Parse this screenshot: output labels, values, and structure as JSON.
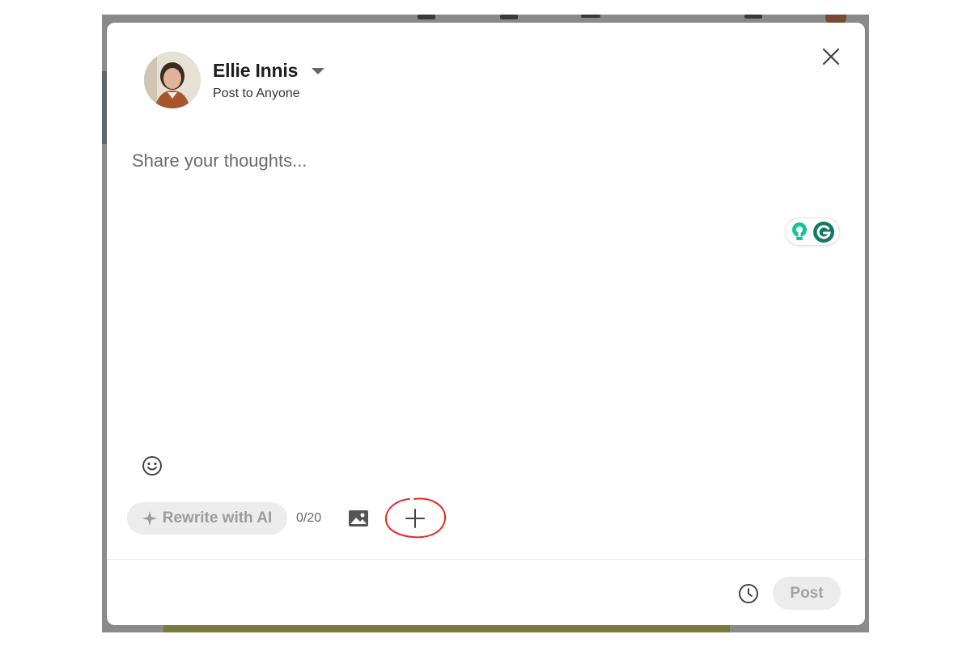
{
  "author": {
    "name": "Ellie Innis",
    "visibility": "Post to Anyone"
  },
  "composer": {
    "placeholder": "Share your thoughts..."
  },
  "toolbar": {
    "rewrite_label": "Rewrite with AI",
    "counter": "0/20"
  },
  "footer": {
    "post_label": "Post"
  },
  "icons": {
    "close": "close-icon",
    "emoji": "smiley-icon",
    "media": "image-icon",
    "more": "plus-icon",
    "schedule": "clock-icon",
    "grammarly_hint": "lightbulb-icon",
    "grammarly": "grammarly-icon"
  },
  "colors": {
    "grammarly_green": "#15c39a",
    "grammarly_dark": "#127a63",
    "annotation_red": "#e02a2a",
    "disabled_button_bg": "#ececec"
  }
}
